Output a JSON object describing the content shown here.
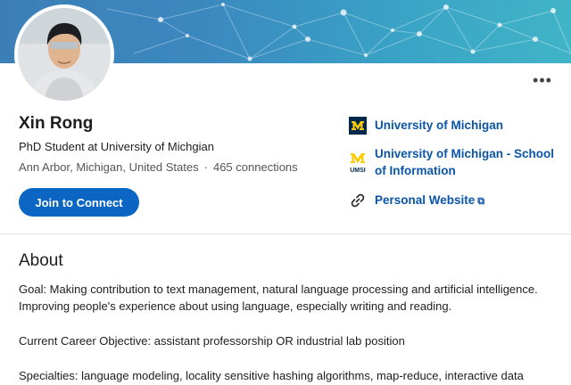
{
  "profile": {
    "name": "Xin Rong",
    "headline": "PhD Student at University of Michgian",
    "location": "Ann Arbor, Michigan, United States",
    "separator": "·",
    "connections": "465 connections",
    "join_label": "Join to Connect",
    "more_label": "•••"
  },
  "sidebar": {
    "education_1": "University of Michigan",
    "education_2_line1": "University of Michigan - School",
    "education_2_line2": "of Information",
    "website": "Personal Website",
    "umsi_logo_text": "UMSI",
    "external_glyph": "⧉"
  },
  "about": {
    "title": "About",
    "line1": "Goal: Making contribution to text management, natural language processing and artificial intelligence.",
    "line2": "Improving people's experience about using language, especially writing and reading.",
    "line3": "Current Career Objective: assistant professorship OR industrial lab position",
    "line4": "Specialties: language modeling, locality sensitive hashing algorithms, map-reduce, interactive data"
  },
  "colors": {
    "brand_blue": "#0a66c2",
    "link_blue": "#0a55a8",
    "michigan_navy": "#00274c",
    "michigan_maize": "#ffcb05"
  }
}
